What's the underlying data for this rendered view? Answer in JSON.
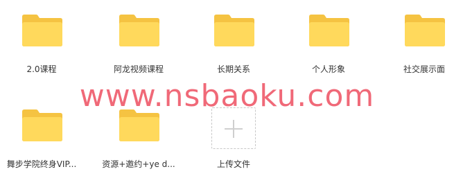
{
  "folders": [
    {
      "label": "2.0课程",
      "icon": "folder-icon"
    },
    {
      "label": "阿龙视频课程",
      "icon": "folder-icon"
    },
    {
      "label": "长期关系",
      "icon": "folder-icon"
    },
    {
      "label": "个人形象",
      "icon": "folder-icon"
    },
    {
      "label": "社交展示面",
      "icon": "folder-icon"
    },
    {
      "label": "舞步学院终身VIP...",
      "icon": "folder-icon"
    },
    {
      "label": "资源+邀约+ye d...",
      "icon": "folder-icon"
    }
  ],
  "upload": {
    "label": "上传文件",
    "icon": "plus-icon"
  },
  "watermark": {
    "text": "www.nsbaoku.com"
  },
  "colors": {
    "folder_back": "#f7c948",
    "folder_front": "#ffd85e",
    "watermark": "#ee5566",
    "text": "#333333"
  }
}
